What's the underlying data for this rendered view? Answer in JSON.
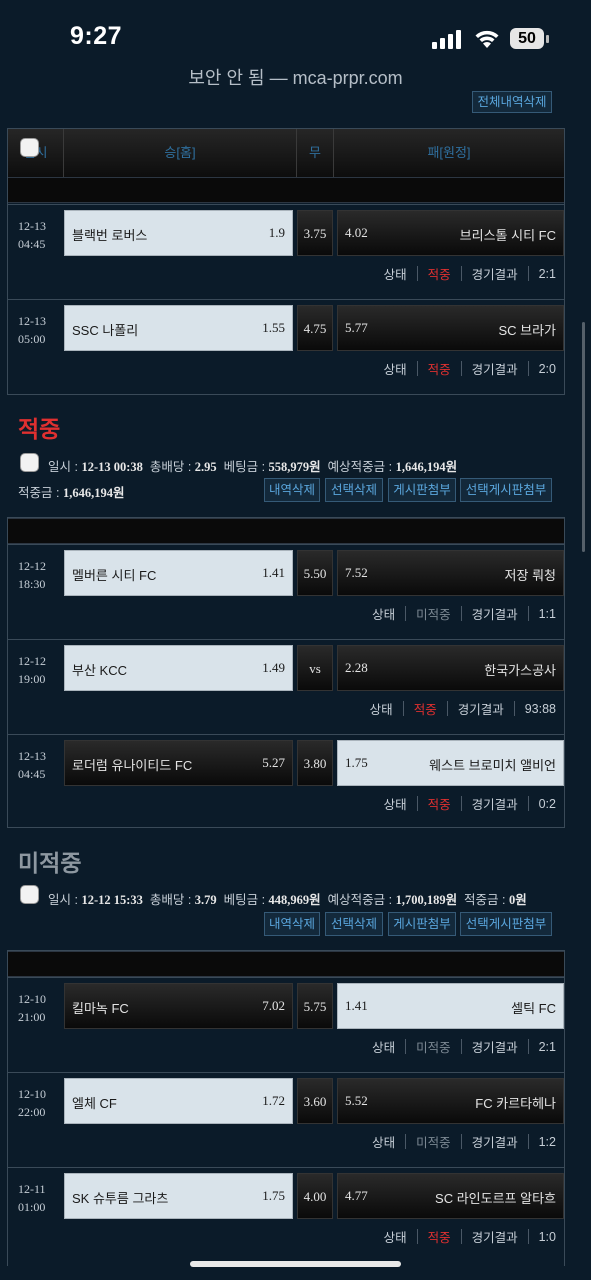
{
  "status_bar": {
    "time": "9:27",
    "battery": "50"
  },
  "browser": {
    "url_text": "보안 안 됨 — mca-prpr.com"
  },
  "top_button": "전체내역삭제",
  "table_header": {
    "date": "일시",
    "win": "승[홈]",
    "draw": "무",
    "lose": "패[원정]"
  },
  "status_labels": {
    "state": "상태",
    "result": "경기결과"
  },
  "section1": {
    "matches": [
      {
        "date": "12-13",
        "time": "04:45",
        "home": "블랙번 로버스",
        "home_odds": "1.9",
        "draw": "3.75",
        "away_odds": "4.02",
        "away": "브리스톨 시티 FC",
        "status": "적중",
        "score": "2:1"
      },
      {
        "date": "12-13",
        "time": "05:00",
        "home": "SSC 나폴리",
        "home_odds": "1.55",
        "draw": "4.75",
        "away_odds": "5.77",
        "away": "SC 브라가",
        "status": "적중",
        "score": "2:0"
      }
    ]
  },
  "section2": {
    "heading": "적중",
    "info": {
      "date_label": "일시 :",
      "date": "12-13 00:38",
      "total_odds_label": "총배당 :",
      "total_odds": "2.95",
      "bet_label": "베팅금 :",
      "bet": "558,979원",
      "expected_label": "예상적중금 :",
      "expected": "1,646,194원",
      "won_label": "적중금 :",
      "won": "1,646,194원"
    },
    "buttons": [
      "내역삭제",
      "선택삭제",
      "게시판첨부",
      "선택게시판첨부"
    ],
    "matches": [
      {
        "date": "12-12",
        "time": "18:30",
        "home": "멜버른 시티 FC",
        "home_odds": "1.41",
        "draw": "5.50",
        "away_odds": "7.52",
        "away": "저장 뤄청",
        "status": "미적중",
        "score": "1:1"
      },
      {
        "date": "12-12",
        "time": "19:00",
        "home": "부산 KCC",
        "home_odds": "1.49",
        "draw": "vs",
        "away_odds": "2.28",
        "away": "한국가스공사",
        "status": "적중",
        "score": "93:88"
      },
      {
        "date": "12-13",
        "time": "04:45",
        "home": "로더럼 유나이티드 FC",
        "home_odds": "5.27",
        "draw": "3.80",
        "away_odds": "1.75",
        "away": "웨스트 브로미치 앨비언",
        "status": "적중",
        "score": "0:2"
      }
    ]
  },
  "section3": {
    "heading": "미적중",
    "info": {
      "date_label": "일시 :",
      "date": "12-12 15:33",
      "total_odds_label": "총배당 :",
      "total_odds": "3.79",
      "bet_label": "베팅금 :",
      "bet": "448,969원",
      "expected_label": "예상적중금 :",
      "expected": "1,700,189원",
      "won_label": "적중금 :",
      "won": "0원"
    },
    "buttons": [
      "내역삭제",
      "선택삭제",
      "게시판첨부",
      "선택게시판첨부"
    ],
    "matches": [
      {
        "date": "12-10",
        "time": "21:00",
        "home": "킬마녹 FC",
        "home_odds": "7.02",
        "draw": "5.75",
        "away_odds": "1.41",
        "away": "셀틱 FC",
        "status": "미적중",
        "score": "2:1"
      },
      {
        "date": "12-10",
        "time": "22:00",
        "home": "엘체 CF",
        "home_odds": "1.72",
        "draw": "3.60",
        "away_odds": "5.52",
        "away": "FC 카르타헤나",
        "status": "미적중",
        "score": "1:2"
      },
      {
        "date": "12-11",
        "time": "01:00",
        "home": "SK 슈투름 그라츠",
        "home_odds": "1.75",
        "draw": "4.00",
        "away_odds": "4.77",
        "away": "SC 라인도르프 알타흐",
        "status": "적중",
        "score": "1:0"
      }
    ]
  }
}
